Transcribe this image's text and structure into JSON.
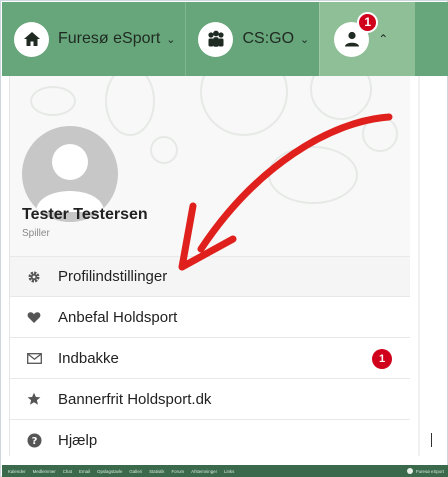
{
  "topbar": {
    "club": {
      "label": "Furesø eSport",
      "icon": "home-icon"
    },
    "team": {
      "label": "CS:GO",
      "icon": "team-icon"
    },
    "profile": {
      "icon": "user-icon",
      "badge": "1"
    }
  },
  "profile_card": {
    "name": "Tester Testersen",
    "role": "Spiller"
  },
  "menu": {
    "items": [
      {
        "label": "Profilindstillinger",
        "icon": "gear-icon"
      },
      {
        "label": "Anbefal Holdsport",
        "icon": "heart-icon"
      },
      {
        "label": "Indbakke",
        "icon": "envelope-icon",
        "badge": "1"
      },
      {
        "label": "Bannerfrit Holdsport.dk",
        "icon": "star-icon"
      },
      {
        "label": "Hjælp",
        "icon": "help-icon"
      }
    ]
  },
  "bottombar": {
    "links": [
      "Kalender",
      "Medlemmer",
      "Chat",
      "Email",
      "Opslagstavle",
      "Galleri",
      "Statistik",
      "Forum",
      "Afstemninger",
      "Links"
    ],
    "right_label": "Furesø eSport"
  },
  "colors": {
    "topbar": "#67a57a",
    "topbar_active": "#8ebf97",
    "badge": "#d0021b",
    "arrow": "#e0201c"
  }
}
